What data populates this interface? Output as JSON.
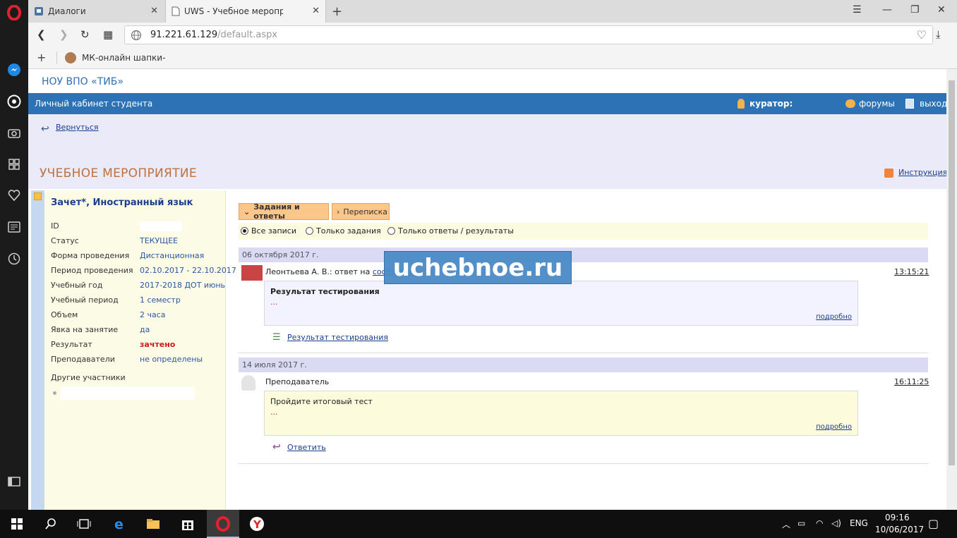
{
  "browser": {
    "tabs": [
      {
        "title": "Диалоги",
        "active": false
      },
      {
        "title": "UWS - Учебное мероприятие",
        "active": true
      }
    ],
    "url_host": "91.221.61.129",
    "url_path": "/default.aspx",
    "bookmark": "МК-онлайн шапки-"
  },
  "site": {
    "title": "НОУ ВПО «ТИБ»",
    "cabinet": "Личный кабинет студента",
    "curator": "куратор:",
    "forums": "форумы",
    "exit": "выход",
    "back": "Вернуться",
    "event_title": "УЧЕБНОЕ МЕРОПРИЯТИЕ",
    "instruction": "Инструкция"
  },
  "details": {
    "heading": "Зачет*, Иностранный язык",
    "rows": [
      {
        "key": "ID",
        "value": ""
      },
      {
        "key": "Статус",
        "value": "ТЕКУЩЕЕ"
      },
      {
        "key": "Форма проведения",
        "value": "Дистанционная"
      },
      {
        "key": "Период проведения",
        "value": "02.10.2017 - 22.10.2017"
      },
      {
        "key": "Учебный год",
        "value": "2017-2018 ДОТ июнь"
      },
      {
        "key": "Учебный период",
        "value": "1 семестр"
      },
      {
        "key": "Объем",
        "value": "2 часа"
      },
      {
        "key": "Явка на занятие",
        "value": "да"
      },
      {
        "key": "Результат",
        "value": "зачтено"
      },
      {
        "key": "Преподаватели",
        "value": "не определены"
      }
    ],
    "others": "Другие участники"
  },
  "tabs": {
    "tasks": "Задания и ответы",
    "correspondence": "Переписка"
  },
  "filters": {
    "all": "Все записи",
    "tasks_only": "Только задания",
    "answers_only": "Только ответы / результаты"
  },
  "messages": [
    {
      "date": "06 октября 2017 г.",
      "author": "Леонтьева А. В.: ответ на",
      "author_link": "сообщение",
      "time": "13:15:21",
      "title": "Результат тестирования",
      "body": "...",
      "more": "подробно",
      "attachment": "Результат тестирования"
    },
    {
      "date": "14 июля 2017 г.",
      "author": "Преподаватель",
      "time": "16:11:25",
      "body": "Пройдите итоговый тест",
      "ellipsis": "...",
      "more": "подробно",
      "reply": "Ответить"
    }
  ],
  "watermark": "uchebnoe.ru",
  "taskbar": {
    "lang": "ENG",
    "time": "09:16",
    "date": "10/06/2017"
  }
}
